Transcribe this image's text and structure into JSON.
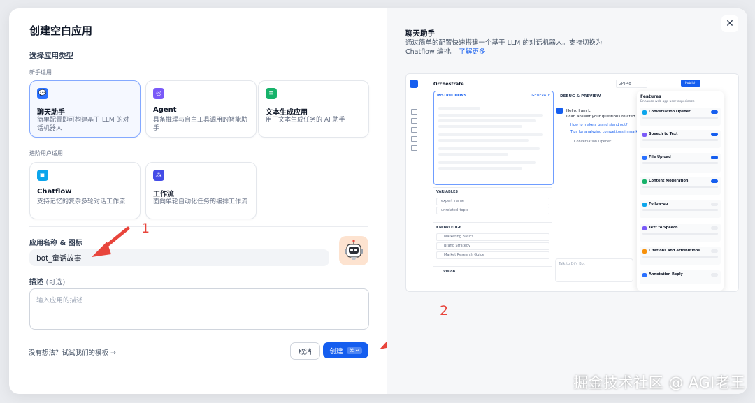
{
  "dialog": {
    "title": "创建空白应用"
  },
  "app_type": {
    "heading": "选择应用类型",
    "beginner_label": "新手适用",
    "advanced_label": "进阶用户适用",
    "cards": [
      {
        "title": "聊天助手",
        "desc": "简单配置即可构建基于 LLM 的对话机器人",
        "icon": "chat-bot-icon",
        "color": "#2970ff",
        "selected": true
      },
      {
        "title": "Agent",
        "desc": "具备推理与自主工具调用的智能助手",
        "icon": "agent-icon",
        "color": "#7a5af8",
        "selected": false
      },
      {
        "title": "文本生成应用",
        "desc": "用于文本生成任务的 AI 助手",
        "icon": "text-generator-icon",
        "color": "#17b26a",
        "selected": false
      },
      {
        "title": "Chatflow",
        "desc": "支持记忆的复杂多轮对话工作流",
        "icon": "chatflow-icon",
        "color": "#0ba5ec",
        "selected": false
      },
      {
        "title": "工作流",
        "desc": "面向单轮自动化任务的编排工作流",
        "icon": "workflow-icon",
        "color": "#444ce7",
        "selected": false
      }
    ]
  },
  "name_section": {
    "label": "应用名称 & 图标",
    "value": "bot_童话故事"
  },
  "description": {
    "label": "描述",
    "optional": "(可选)",
    "placeholder": "输入应用的描述"
  },
  "footer": {
    "template_link": "没有想法？试试我们的模板 →",
    "cancel": "取消",
    "create": "创建",
    "create_kbd": "⌘ ↵"
  },
  "annotations": {
    "arrow1": "1",
    "arrow2": "2",
    "color": "#e8453c"
  },
  "preview": {
    "title": "聊天助手",
    "desc": "通过简单的配置快速搭建一个基于 LLM 的对话机器人。支持切换为 Chatflow 编排。",
    "learn_more": "了解更多",
    "orchestrate": "Orchestrate",
    "model": "GPT-4o",
    "publish": "Publish",
    "instructions": "INSTRUCTIONS",
    "generate": "GENERATE",
    "debug": "DEBUG & PREVIEW",
    "greeting": "Hello, I am L.",
    "greeting2": "I can answer your questions related",
    "suggest1": "How to make a brand stand out?",
    "suggest2": "Tips for analyzing competitors in market",
    "opener": "Conversation Opener",
    "variables": "VARIABLES",
    "var_rows": [
      "expert_name",
      "unrelated_topic"
    ],
    "knowledge": "KNOWLEDGE",
    "know_rows": [
      "Marketing Basics",
      "Brand Strategy",
      "Market Research Guide"
    ],
    "vision": "Vision",
    "talk": "Talk to Dify Bot",
    "features_title": "Features",
    "features_sub": "Enhance web app user experience",
    "features": [
      {
        "name": "Conversation Opener",
        "color": "#0ba5ec",
        "on": true
      },
      {
        "name": "Speech to Text",
        "color": "#7a5af8",
        "on": true
      },
      {
        "name": "File Upload",
        "color": "#2970ff",
        "on": true
      },
      {
        "name": "Content Moderation",
        "color": "#17b26a",
        "on": true
      },
      {
        "name": "Follow-up",
        "color": "#0ba5ec",
        "on": false
      },
      {
        "name": "Text to Speech",
        "color": "#7a5af8",
        "on": false
      },
      {
        "name": "Citations and Attributions",
        "color": "#f79009",
        "on": false
      },
      {
        "name": "Annotation Reply",
        "color": "#2970ff",
        "on": false
      }
    ]
  },
  "watermark": "掘金技术社区 @ AGI老王"
}
